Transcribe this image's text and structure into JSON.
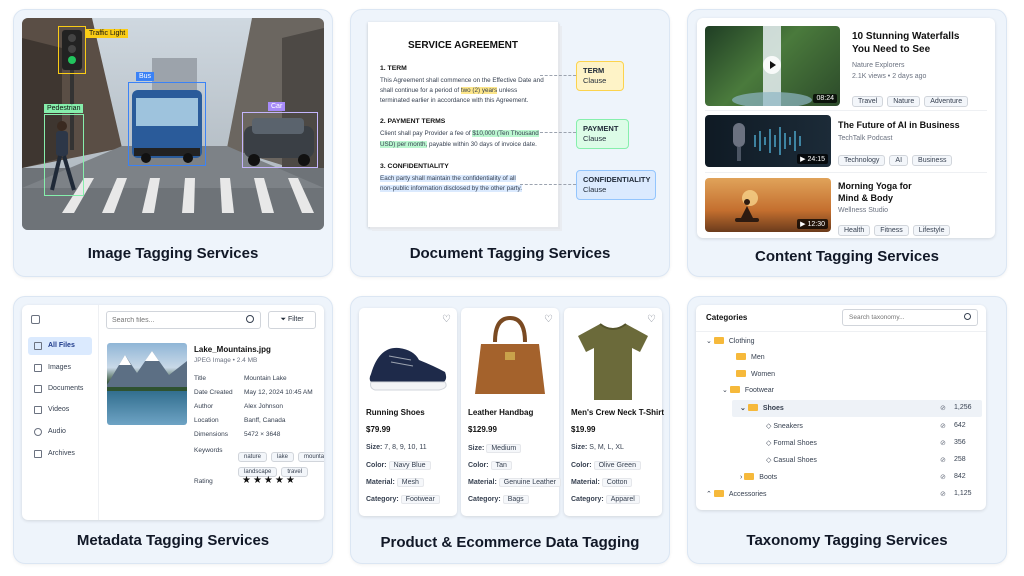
{
  "cards": [
    {
      "title": "Image Tagging Services"
    },
    {
      "title": "Document Tagging Services"
    },
    {
      "title": "Content Tagging Services"
    },
    {
      "title": "Metadata Tagging Services"
    },
    {
      "title": "Product & Ecommerce Data Tagging"
    },
    {
      "title": "Taxonomy Tagging Services"
    }
  ],
  "image_tags": [
    "Traffic Light",
    "Bus",
    "Pedestrian",
    "Car"
  ],
  "document": {
    "title": "SERVICE AGREEMENT",
    "s1_head": "1. TERM",
    "s1_a": "This Agreement shall commence on the Effective Date and",
    "s1_b_pre": "shall continue for a period of ",
    "s1_b_hl": "two (2) years",
    "s1_b_post": " unless",
    "s1_c": "terminated earlier in accordance with this Agreement.",
    "s2_head": "2. PAYMENT TERMS",
    "s2_a_pre": "Client shall pay Provider a fee of ",
    "s2_a_hl": "$10,000 (Ten Thousand",
    "s2_b_hl": "USD) per month,",
    "s2_b_post": " payable within 30 days of invoice date.",
    "s3_head": "3. CONFIDENTIALITY",
    "s3_a": "Each party shall maintain the confidentiality of all",
    "s3_b": "non-public information disclosed by the other party.",
    "callouts": [
      {
        "title": "TERM",
        "sub": "Clause"
      },
      {
        "title": "PAYMENT",
        "sub": "Clause"
      },
      {
        "title": "CONFIDENTIALITY",
        "sub": "Clause"
      }
    ]
  },
  "videos": [
    {
      "title1": "10 Stunning Waterfalls",
      "title2": "You Need to See",
      "channel": "Nature Explorers",
      "meta": "2.1K views • 2 days ago",
      "duration": "08:24",
      "tags": [
        "Travel",
        "Nature",
        "Adventure"
      ]
    },
    {
      "title1": "The Future of AI in Business",
      "title2": "",
      "channel": "TechTalk Podcast",
      "meta": "",
      "duration": "24:15",
      "tags": [
        "Technology",
        "AI",
        "Business"
      ]
    },
    {
      "title1": "Morning Yoga for",
      "title2": "Mind & Body",
      "channel": "Wellness Studio",
      "meta": "",
      "duration": "12:30",
      "tags": [
        "Health",
        "Fitness",
        "Lifestyle"
      ]
    }
  ],
  "files": {
    "search_placeholder": "Search files...",
    "filter": "Filter",
    "sidebar": [
      "All Files",
      "Images",
      "Documents",
      "Videos",
      "Audio",
      "Archives"
    ],
    "filename": "Lake_Mountains.jpg",
    "filetype": "JPEG Image • 2.4 MB",
    "fields": [
      {
        "label": "Title",
        "value": "Mountain Lake"
      },
      {
        "label": "Date Created",
        "value": "May 12, 2024 10:45 AM"
      },
      {
        "label": "Author",
        "value": "Alex Johnson"
      },
      {
        "label": "Location",
        "value": "Banff, Canada"
      },
      {
        "label": "Dimensions",
        "value": "5472 × 3648"
      }
    ],
    "keywords_label": "Keywords",
    "keywords": [
      "nature",
      "lake",
      "mountains",
      "landscape",
      "travel"
    ],
    "rating_label": "Rating",
    "rating": 5
  },
  "products": [
    {
      "name": "Running Shoes",
      "price": "$79.99",
      "size": "7, 8, 9, 10, 11",
      "color": "Navy Blue",
      "material": "Mesh",
      "category": "Footwear"
    },
    {
      "name": "Leather Handbag",
      "price": "$129.99",
      "size": "Medium",
      "color": "Tan",
      "material": "Genuine Leather",
      "category": "Bags"
    },
    {
      "name": "Men's Crew Neck T-Shirt",
      "price": "$19.99",
      "size": "S, M, L, XL",
      "color": "Olive Green",
      "material": "Cotton",
      "category": "Apparel"
    }
  ],
  "product_labels": {
    "size": "Size:",
    "color": "Color:",
    "material": "Material:",
    "category": "Category:"
  },
  "taxonomy": {
    "header": "Categories",
    "search_placeholder": "Search taxonomy...",
    "items": [
      {
        "label": "Clothing",
        "count": ""
      },
      {
        "label": "Men",
        "count": ""
      },
      {
        "label": "Women",
        "count": ""
      },
      {
        "label": "Footwear",
        "count": ""
      },
      {
        "label": "Shoes",
        "count": "1,256"
      },
      {
        "label": "Sneakers",
        "count": "642"
      },
      {
        "label": "Formal Shoes",
        "count": "356"
      },
      {
        "label": "Casual Shoes",
        "count": "258"
      },
      {
        "label": "Boots",
        "count": "842"
      },
      {
        "label": "Accessories",
        "count": "1,125"
      }
    ]
  }
}
